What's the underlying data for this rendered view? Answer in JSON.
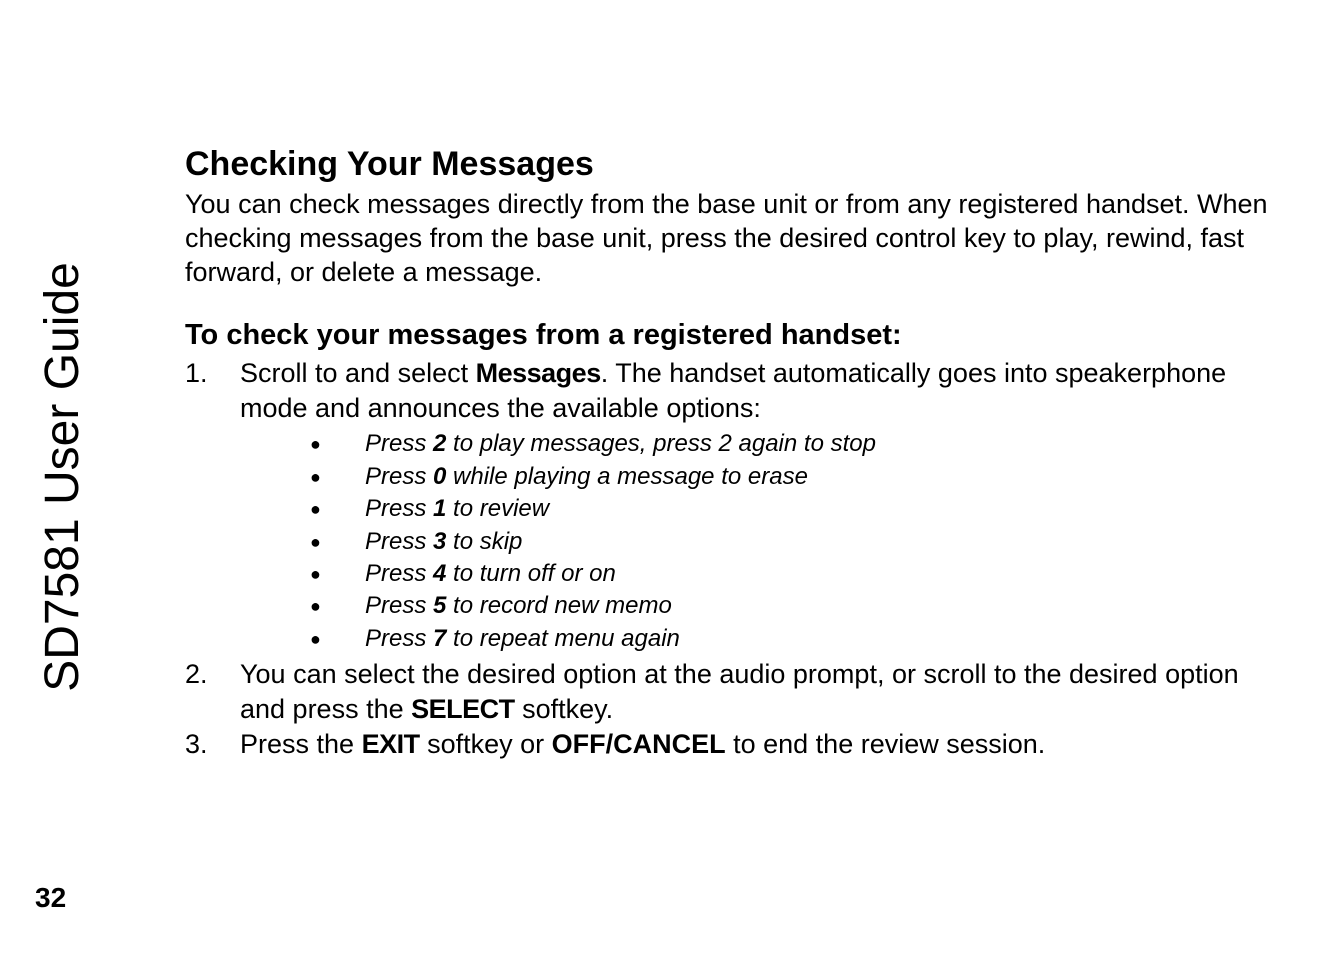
{
  "sideLabel": "SD7581 User Guide",
  "pageNumber": "32",
  "section": {
    "title": "Checking Your Messages",
    "intro": "You can check messages directly from the base unit or from any registered handset. When checking messages from the base unit, press the desired control key to play, rewind, fast forward, or delete a message.",
    "subsectionTitle": "To check your messages from a registered handset:",
    "steps": {
      "s1": {
        "num": "1.",
        "prefix": "Scroll to and select ",
        "menu": "Messages",
        "suffix": ". The handset automatically goes into speakerphone mode and announces the available options:"
      },
      "bullets": {
        "b1": {
          "pre": "Press ",
          "key": "2",
          "post": " to play messages, press 2 again to stop"
        },
        "b2": {
          "pre": "Press ",
          "key": "0",
          "post": " while playing a message to erase"
        },
        "b3": {
          "pre": "Press ",
          "key": "1",
          "post": " to review"
        },
        "b4": {
          "pre": "Press ",
          "key": "3",
          "post": " to skip"
        },
        "b5": {
          "pre": "Press ",
          "key": "4",
          "post": " to turn off or on"
        },
        "b6": {
          "pre": "Press ",
          "key": "5",
          "post": " to record new memo"
        },
        "b7": {
          "pre": "Press ",
          "key": "7",
          "post": " to repeat menu again"
        }
      },
      "s2": {
        "num": "2.",
        "prefix": "You can select the desired option at the audio prompt, or scroll to the desired option and press the ",
        "menu": "SELECT",
        "suffix": " softkey."
      },
      "s3": {
        "num": "3.",
        "prefix": "Press the ",
        "menu": "EXIT",
        "mid": " softkey or ",
        "label": "OFF/CANCEL",
        "suffix": " to end the review session."
      }
    }
  }
}
